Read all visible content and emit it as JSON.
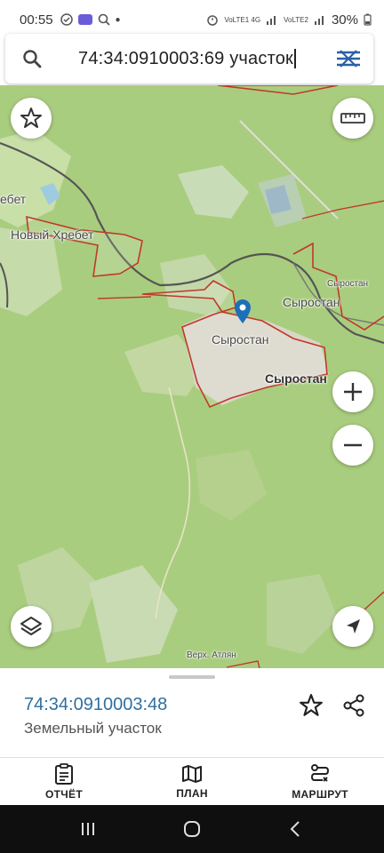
{
  "status_bar": {
    "time": "00:55",
    "network_left": "VoLTE1 4G",
    "network_right": "VoLTE2",
    "battery": "30%"
  },
  "search": {
    "query": "74:34:0910003:69 участок"
  },
  "map": {
    "labels": {
      "novy_hrebet": "Новый Хребет",
      "hrebet": "ебет",
      "syrostan_top": "Сыростан",
      "syrostan_center": "Сыростан",
      "syrostan_bold": "Сыростан",
      "syrostan_far": "Сыростан",
      "verkh_atlyan": "Верх. Атлян"
    },
    "colors": {
      "land": "#a9cd7e",
      "forest": "#b7d68c",
      "parcel_outline": "#c0392b",
      "road": "#555555",
      "pin": "#1d6fb8"
    }
  },
  "sheet": {
    "cadastral_number": "74:34:0910003:48",
    "object_type": "Земельный участок"
  },
  "bottom_nav": {
    "report": "ОТЧЁТ",
    "plan": "ПЛАН",
    "route": "МАРШРУТ"
  },
  "icons": [
    "search-icon",
    "menu-icon",
    "star-icon",
    "ruler-icon",
    "zoom-in-icon",
    "zoom-out-icon",
    "layers-icon",
    "locate-icon",
    "share-icon",
    "report-icon",
    "map-icon",
    "route-icon",
    "location-pin-icon"
  ]
}
